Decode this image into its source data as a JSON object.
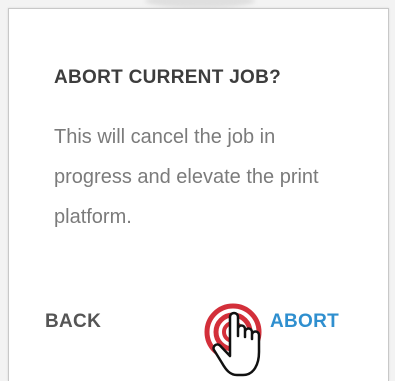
{
  "dialog": {
    "title": "ABORT CURRENT JOB?",
    "message": "This will cancel the job in progress and elevate the print platform.",
    "back_label": "BACK",
    "abort_label": "ABORT"
  },
  "colors": {
    "title": "#3d3d3d",
    "message": "#7b7b7b",
    "back": "#555555",
    "abort": "#2f8fcf",
    "tap_ring": "#d32f3a"
  },
  "icons": {
    "tap_indicator": "hand-pointer-tap-icon"
  }
}
